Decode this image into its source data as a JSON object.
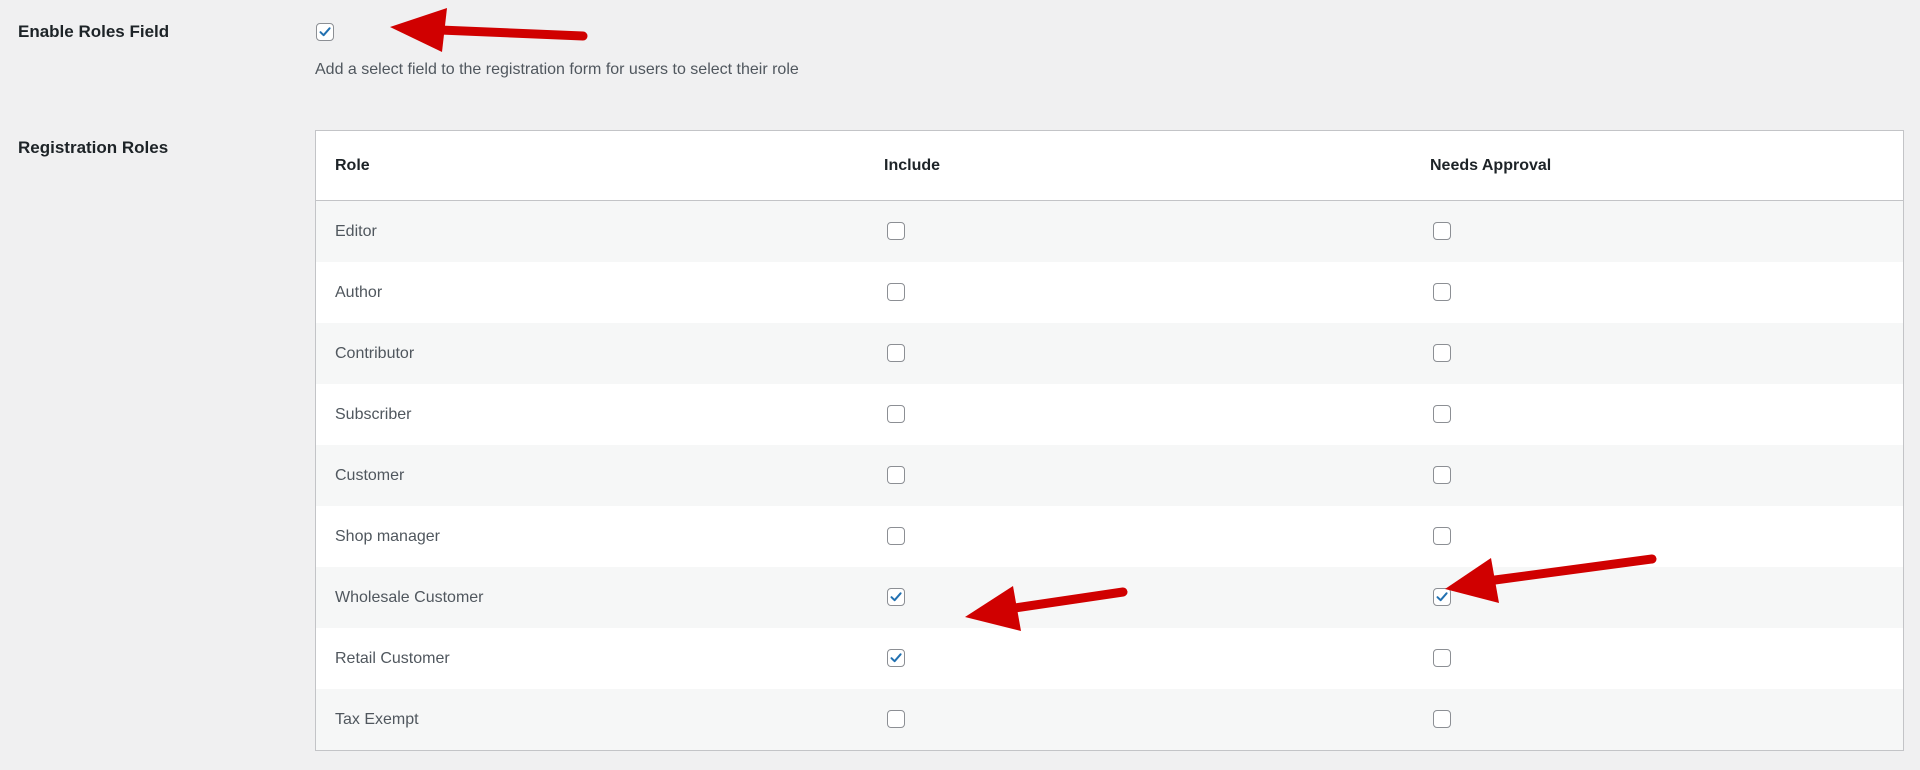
{
  "enable_roles": {
    "label": "Enable Roles Field",
    "checked": true,
    "description": "Add a select field to the registration form for users to select their role"
  },
  "registration_roles": {
    "label": "Registration Roles",
    "columns": {
      "role": "Role",
      "include": "Include",
      "needs_approval": "Needs Approval"
    },
    "rows": [
      {
        "role": "Editor",
        "include": false,
        "needs_approval": false
      },
      {
        "role": "Author",
        "include": false,
        "needs_approval": false
      },
      {
        "role": "Contributor",
        "include": false,
        "needs_approval": false
      },
      {
        "role": "Subscriber",
        "include": false,
        "needs_approval": false
      },
      {
        "role": "Customer",
        "include": false,
        "needs_approval": false
      },
      {
        "role": "Shop manager",
        "include": false,
        "needs_approval": false
      },
      {
        "role": "Wholesale Customer",
        "include": true,
        "needs_approval": true
      },
      {
        "role": "Retail Customer",
        "include": true,
        "needs_approval": false
      },
      {
        "role": "Tax Exempt",
        "include": false,
        "needs_approval": false
      }
    ]
  },
  "colors": {
    "checkmark": "#2271b1",
    "annotation_arrow": "#d00000"
  }
}
